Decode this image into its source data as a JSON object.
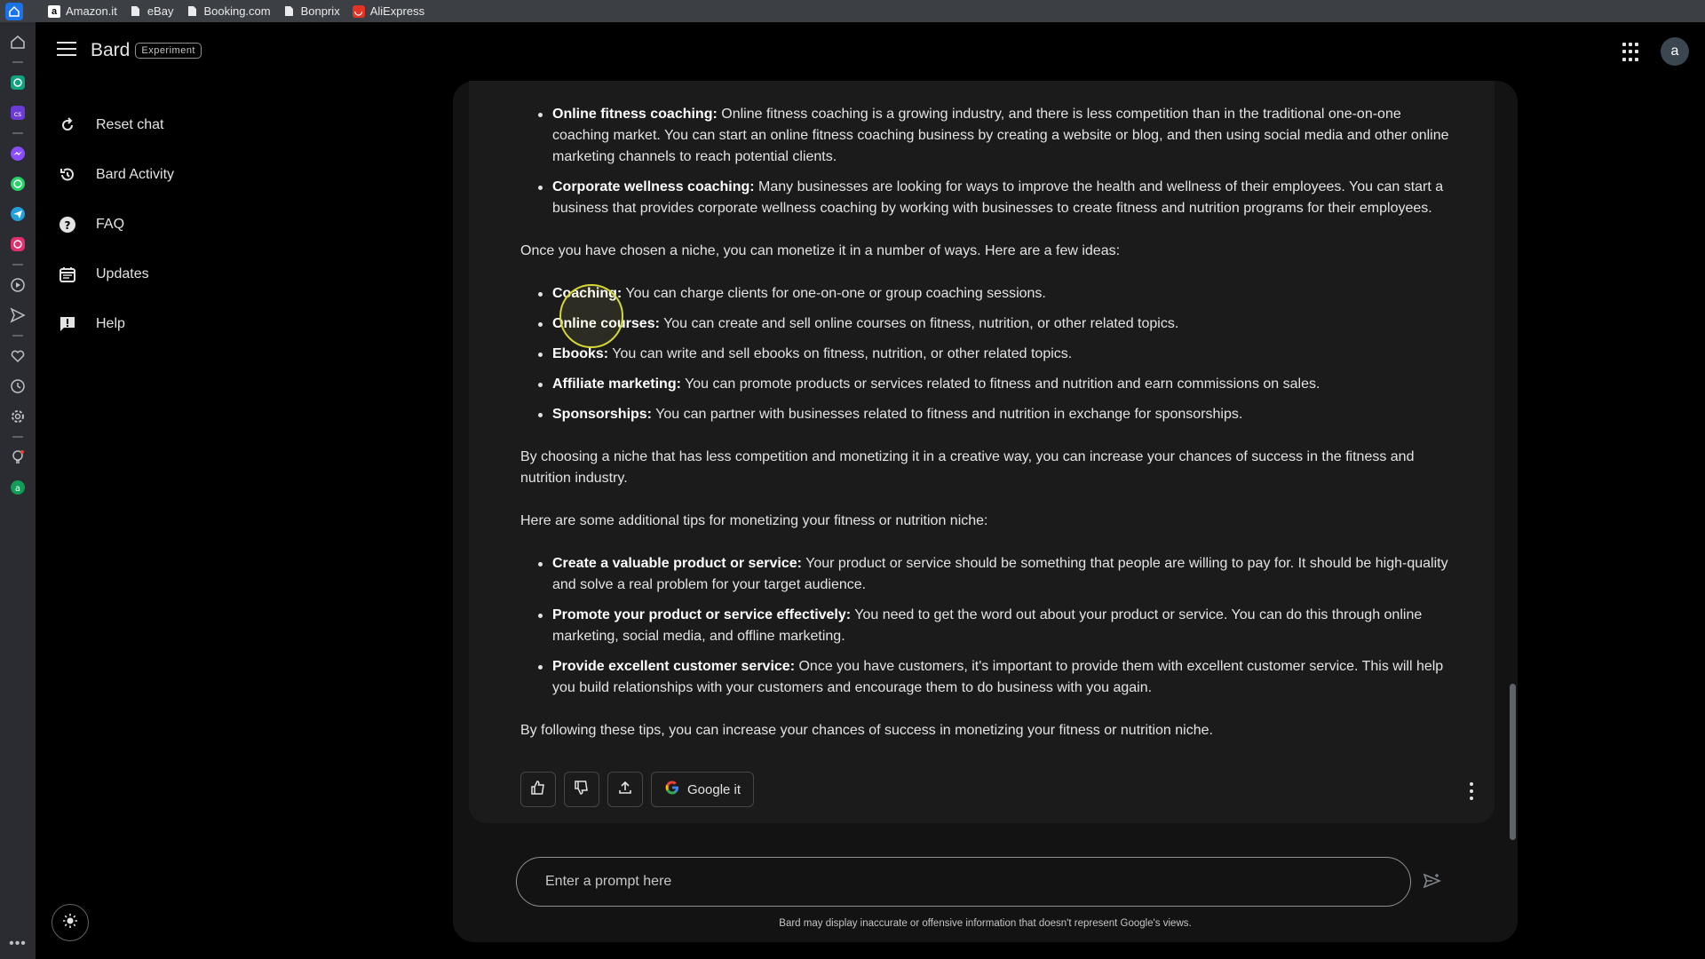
{
  "bookmarks": [
    {
      "label": "Amazon.it",
      "icon": "amazon-icon"
    },
    {
      "label": "eBay",
      "icon": "document-icon"
    },
    {
      "label": "Booking.com",
      "icon": "document-icon"
    },
    {
      "label": "Bonprix",
      "icon": "document-icon"
    },
    {
      "label": "AliExpress",
      "icon": "aliexpress-icon"
    }
  ],
  "header": {
    "brand": "Bard",
    "badge": "Experiment",
    "avatar_letter": "a"
  },
  "sidebar": {
    "items": [
      {
        "label": "Reset chat",
        "icon": "reset-icon"
      },
      {
        "label": "Bard Activity",
        "icon": "history-icon"
      },
      {
        "label": "FAQ",
        "icon": "help-circle-icon"
      },
      {
        "label": "Updates",
        "icon": "calendar-icon"
      },
      {
        "label": "Help",
        "icon": "feedback-icon"
      }
    ]
  },
  "response": {
    "niches": [
      {
        "title": "Online fitness coaching:",
        "text": " Online fitness coaching is a growing industry, and there is less competition than in the traditional one-on-one coaching market. You can start an online fitness coaching business by creating a website or blog, and then using social media and other online marketing channels to reach potential clients."
      },
      {
        "title": "Corporate wellness coaching:",
        "text": " Many businesses are looking for ways to improve the health and wellness of their employees. You can start a business that provides corporate wellness coaching by working with businesses to create fitness and nutrition programs for their employees."
      }
    ],
    "intro_monetize": "Once you have chosen a niche, you can monetize it in a number of ways. Here are a few ideas:",
    "ideas": [
      {
        "title": "Coaching:",
        "text": " You can charge clients for one-on-one or group coaching sessions."
      },
      {
        "title": "Online courses:",
        "text": " You can create and sell online courses on fitness, nutrition, or other related topics."
      },
      {
        "title": "Ebooks:",
        "text": " You can write and sell ebooks on fitness, nutrition, or other related topics."
      },
      {
        "title": "Affiliate marketing:",
        "text": " You can promote products or services related to fitness and nutrition and earn commissions on sales."
      },
      {
        "title": "Sponsorships:",
        "text": " You can partner with businesses related to fitness and nutrition in exchange for sponsorships."
      }
    ],
    "summary": "By choosing a niche that has less competition and monetizing it in a creative way, you can increase your chances of success in the fitness and nutrition industry.",
    "tips_intro": "Here are some additional tips for monetizing your fitness or nutrition niche:",
    "tips": [
      {
        "title": "Create a valuable product or service:",
        "text": " Your product or service should be something that people are willing to pay for. It should be high-quality and solve a real problem for your target audience."
      },
      {
        "title": "Promote your product or service effectively:",
        "text": " You need to get the word out about your product or service. You can do this through online marketing, social media, and offline marketing."
      },
      {
        "title": "Provide excellent customer service:",
        "text": " Once you have customers, it's important to provide them with excellent customer service. This will help you build relationships with your customers and encourage them to do business with you again."
      }
    ],
    "closing": "By following these tips, you can increase your chances of success in monetizing your fitness or nutrition niche."
  },
  "actions": {
    "google_it": "Google it"
  },
  "prompt": {
    "placeholder": "Enter a prompt here"
  },
  "disclaimer": "Bard may display inaccurate or offensive information that doesn't represent Google's views.",
  "colors": {
    "background": "#000000",
    "panel": "#131314",
    "card": "#1b1b1c",
    "text": "#e3e3e3",
    "highlight_ring": "#d6d635"
  }
}
